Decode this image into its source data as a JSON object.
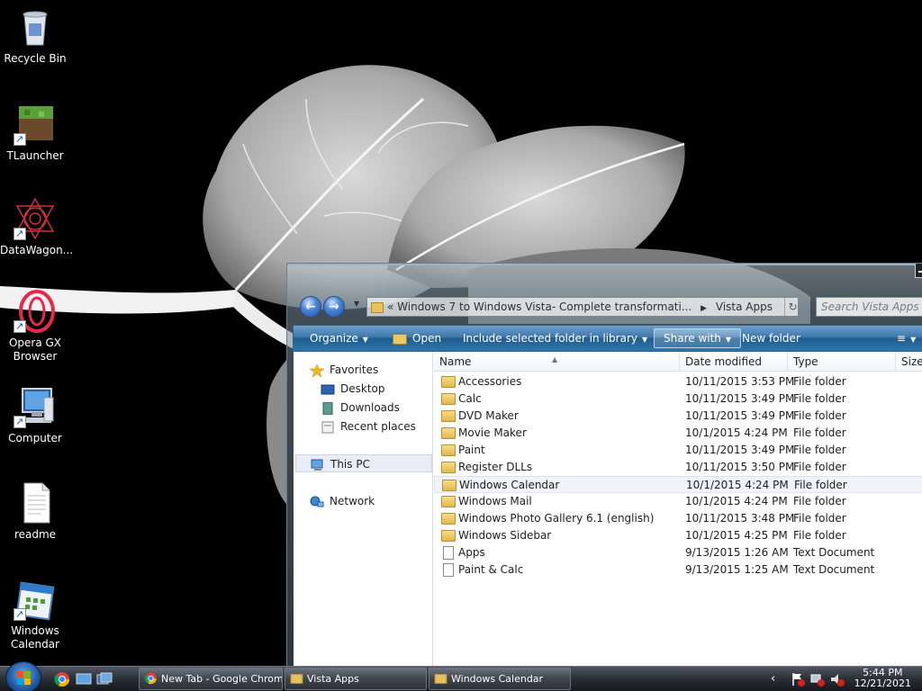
{
  "desktop": {
    "icons": [
      {
        "label": "Recycle Bin",
        "icon": "recycle-bin-icon"
      },
      {
        "label": "TLauncher",
        "icon": "tlauncher-icon"
      },
      {
        "label": "DataWagon...",
        "icon": "datawagon-icon"
      },
      {
        "label": "Opera GX Browser",
        "icon": "opera-gx-icon"
      },
      {
        "label": "Computer",
        "icon": "computer-icon"
      },
      {
        "label": "readme",
        "icon": "text-document-icon"
      },
      {
        "label": "Windows Calendar",
        "icon": "windows-calendar-icon"
      }
    ]
  },
  "explorer": {
    "address": {
      "prefix": "«",
      "segment1": "Windows 7 to Windows Vista- Complete transformati...",
      "segment2": "Vista Apps"
    },
    "search_placeholder": "Search Vista Apps",
    "toolbar": {
      "organize": "Organize",
      "open": "Open",
      "include": "Include selected folder in library",
      "share": "Share with",
      "new_folder": "New folder"
    },
    "nav": {
      "favorites": "Favorites",
      "desktop": "Desktop",
      "downloads": "Downloads",
      "recent": "Recent places",
      "this_pc": "This PC",
      "network": "Network"
    },
    "columns": {
      "name": "Name",
      "date": "Date modified",
      "type": "Type",
      "size": "Size"
    },
    "rows": [
      {
        "name": "Accessories",
        "date": "10/11/2015 3:53 PM",
        "type": "File folder",
        "kind": "folder"
      },
      {
        "name": "Calc",
        "date": "10/11/2015 3:49 PM",
        "type": "File folder",
        "kind": "folder"
      },
      {
        "name": "DVD Maker",
        "date": "10/11/2015 3:49 PM",
        "type": "File folder",
        "kind": "folder"
      },
      {
        "name": "Movie Maker",
        "date": "10/1/2015 4:24 PM",
        "type": "File folder",
        "kind": "folder"
      },
      {
        "name": "Paint",
        "date": "10/11/2015 3:49 PM",
        "type": "File folder",
        "kind": "folder"
      },
      {
        "name": "Register DLLs",
        "date": "10/11/2015 3:50 PM",
        "type": "File folder",
        "kind": "folder"
      },
      {
        "name": "Windows Calendar",
        "date": "10/1/2015 4:24 PM",
        "type": "File folder",
        "kind": "folder"
      },
      {
        "name": "Windows Mail",
        "date": "10/1/2015 4:24 PM",
        "type": "File folder",
        "kind": "folder"
      },
      {
        "name": "Windows Photo Gallery 6.1 (english)",
        "date": "10/11/2015 3:48 PM",
        "type": "File folder",
        "kind": "folder"
      },
      {
        "name": "Windows Sidebar",
        "date": "10/1/2015 4:25 PM",
        "type": "File folder",
        "kind": "folder"
      },
      {
        "name": "Apps",
        "date": "9/13/2015 1:26 AM",
        "type": "Text Document",
        "kind": "document"
      },
      {
        "name": "Paint & Calc",
        "date": "9/13/2015 1:25 AM",
        "type": "Text Document",
        "kind": "document"
      }
    ]
  },
  "taskbar": {
    "buttons": [
      {
        "label": "New Tab - Google Chrome",
        "icon": "chrome-icon"
      },
      {
        "label": "Vista Apps",
        "icon": "folder-icon"
      },
      {
        "label": "Windows Calendar",
        "icon": "folder-icon"
      }
    ],
    "clock": {
      "time": "5:44 PM",
      "date": "12/21/2021"
    }
  },
  "colors": {
    "desktop_bg": "#000000",
    "toolbar_blue": "#2f6c9f",
    "folder_yellow": "#e6c35a",
    "taskbar": "#2a2f37"
  }
}
